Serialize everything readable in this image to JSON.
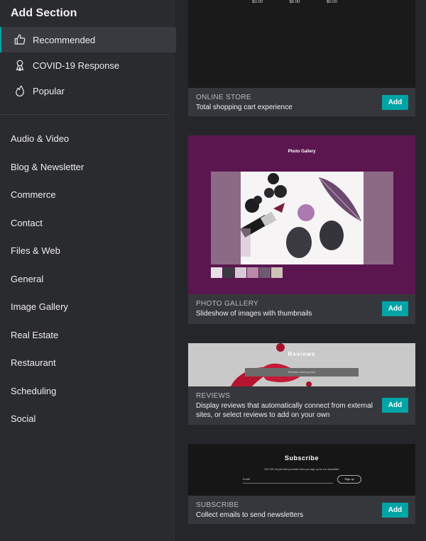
{
  "sidebar": {
    "title": "Add Section",
    "featured": [
      {
        "label": "Recommended",
        "icon": "thumbs-up-icon",
        "active": true
      },
      {
        "label": "COVID-19 Response",
        "icon": "ribbon-icon",
        "active": false
      },
      {
        "label": "Popular",
        "icon": "flame-icon",
        "active": false
      }
    ],
    "categories": [
      "Audio & Video",
      "Blog & Newsletter",
      "Commerce",
      "Contact",
      "Files & Web",
      "General",
      "Image Gallery",
      "Real Estate",
      "Restaurant",
      "Scheduling",
      "Social"
    ]
  },
  "cards": [
    {
      "title": "ONLINE STORE",
      "description": "Total shopping cart experience",
      "add_label": "Add",
      "preview": {
        "prices": [
          "$0.00",
          "$0.00",
          "$0.00"
        ]
      }
    },
    {
      "title": "PHOTO GALLERY",
      "description": "Slideshow of images with thumbnails",
      "add_label": "Add",
      "preview": {
        "heading": "Photo Gallery"
      }
    },
    {
      "title": "REVIEWS",
      "description": "Display reviews that automatically connect from external sites, or select reviews to add on your own",
      "add_label": "Add",
      "preview": {
        "heading": "Reviews",
        "bar_text": "Reviews coming soon"
      }
    },
    {
      "title": "SUBSCRIBE",
      "description": "Collect emails to send newsletters",
      "add_label": "Add",
      "preview": {
        "heading": "Subscribe",
        "text": "Get 10% off your first purchase when you sign up for our newsletter!",
        "email_label": "Email",
        "button": "Sign up"
      }
    }
  ],
  "colors": {
    "accent": "#00a4a6",
    "sidebar_bg": "#2a2b2f",
    "card_bg": "#36373c"
  }
}
